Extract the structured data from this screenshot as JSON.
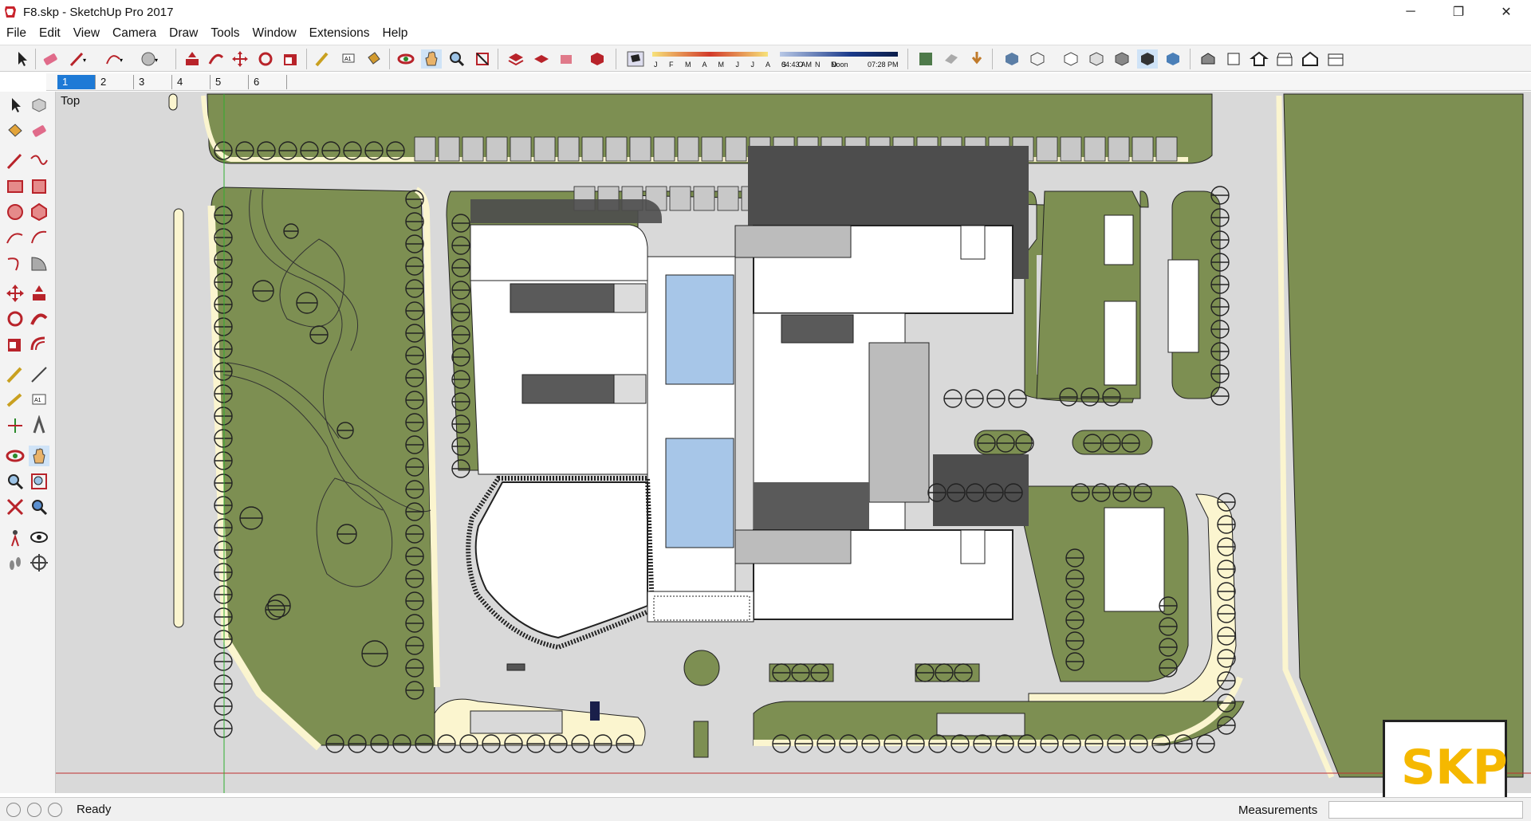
{
  "window": {
    "title": "F8.skp - SketchUp Pro 2017",
    "controls": {
      "minimize": "─",
      "maximize": "❐",
      "close": "✕"
    }
  },
  "menu": [
    "File",
    "Edit",
    "View",
    "Camera",
    "Draw",
    "Tools",
    "Window",
    "Extensions",
    "Help"
  ],
  "shadows": {
    "months": "J F M A M J J A S O N D",
    "time_start": "04:43 AM",
    "time_mid": "Noon",
    "time_end": "07:28 PM"
  },
  "scene_tabs": [
    {
      "label": "1",
      "active": true
    },
    {
      "label": "2",
      "active": false
    },
    {
      "label": "3",
      "active": false
    },
    {
      "label": "4",
      "active": false
    },
    {
      "label": "5",
      "active": false
    },
    {
      "label": "6",
      "active": false
    }
  ],
  "viewport": {
    "view_label": "Top"
  },
  "status": {
    "text": "Ready",
    "measurements_label": "Measurements",
    "measurements_value": ""
  },
  "logo": {
    "text": "SKP"
  },
  "colors": {
    "grass": "#7d8f52",
    "road": "#d9d9d9",
    "path": "#fbf5cf",
    "building": "#ffffff",
    "shadow": "#4d4d4d",
    "pool": "#a7c6e8",
    "accent": "#f5b800"
  }
}
